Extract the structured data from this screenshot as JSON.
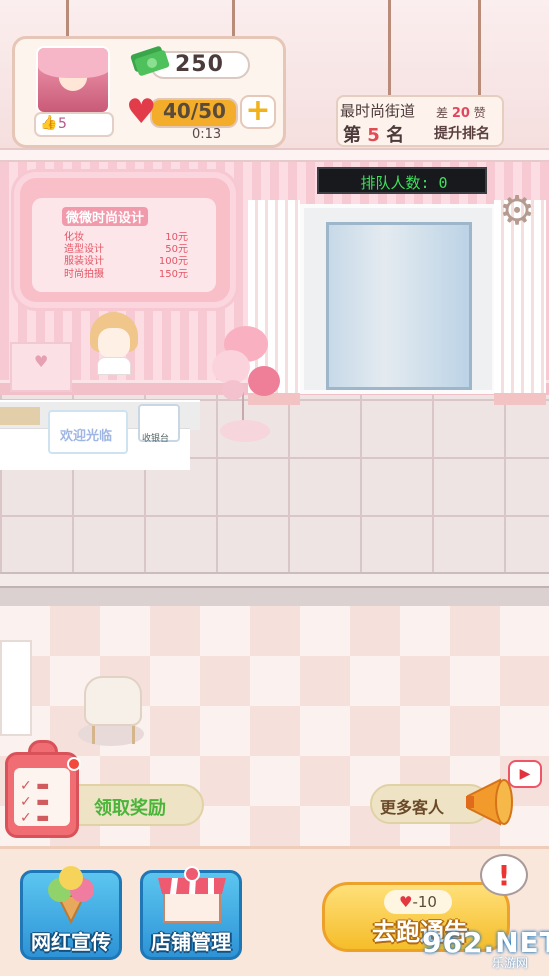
{
  "player": {
    "level": "5",
    "money": "250",
    "stamina": "40/50",
    "timer": "0:13"
  },
  "ranking": {
    "title": "最时尚街道",
    "rank_prefix": "第",
    "rank_number": "5",
    "rank_suffix": "名",
    "gap_prefix": "差",
    "gap_value": "20",
    "gap_unit": "赞",
    "promote_label": "提升排名"
  },
  "queue": {
    "label": "排队人数: 0"
  },
  "price_board": {
    "title": "微微时尚设计",
    "rows": [
      {
        "item": "化妆",
        "price": "10元"
      },
      {
        "item": "造型设计",
        "price": "50元"
      },
      {
        "item": "服装设计",
        "price": "100元"
      },
      {
        "item": "时尚拍摄",
        "price": "150元"
      }
    ]
  },
  "counter": {
    "stand_text": "欢迎光临",
    "cashier_text": "收银台"
  },
  "actions": {
    "task_label": "领取奖励",
    "more_customers_label": "更多客人",
    "promote_button_label": "网红宣传",
    "shop_button_label": "店铺管理",
    "run_cost": "-10",
    "run_label": "去跑通告",
    "exclaim": "!",
    "tv_icon": "▶"
  },
  "watermark": {
    "main": "962.NET",
    "sub": "乐游网"
  },
  "icons": {
    "money": "money-stack-icon",
    "heart": "heart-icon",
    "plus": "plus-icon",
    "gear": "gear-icon",
    "task": "clipboard-icon",
    "horn": "megaphone-icon"
  },
  "colors": {
    "accent_pink": "#f7c9d3",
    "heart_red": "#e23c4b",
    "queue_green": "#3ee05d",
    "button_blue": "#2d93d6",
    "button_yellow": "#f5bd2a"
  }
}
